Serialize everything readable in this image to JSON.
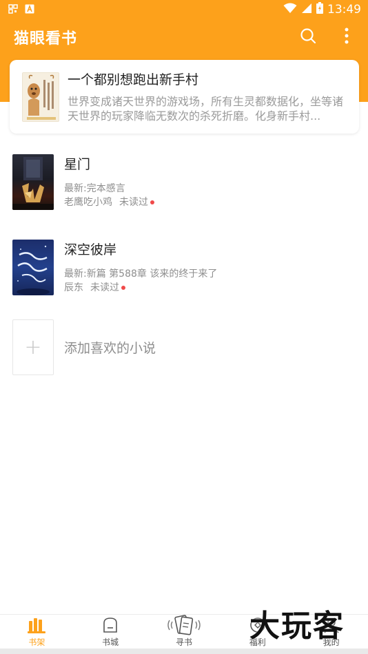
{
  "status_bar": {
    "time": "13:49",
    "left_icons": [
      "qr-icon",
      "a-icon"
    ],
    "right_icons": [
      "wifi-icon",
      "signal-icon",
      "battery-icon"
    ]
  },
  "header": {
    "title": "猫眼看书",
    "actions": [
      "search-icon",
      "more-icon"
    ]
  },
  "featured": {
    "title": "一个都别想跑出新手村",
    "description": "世界变成诸天世界的游戏场，所有生灵都数据化，坐等诸天世界的玩家降临无数次的杀死折磨。化身新手村..."
  },
  "books": [
    {
      "title": "星门",
      "latest": "最新:完本感言",
      "author": "老鹰吃小鸡",
      "status": "未读过"
    },
    {
      "title": "深空彼岸",
      "latest": "最新:新篇 第588章 该来的终于来了",
      "author": "辰东",
      "status": "未读过"
    }
  ],
  "add_book": {
    "symbol": "+",
    "label": "添加喜欢的小说"
  },
  "bottom_nav": [
    {
      "label": "书架",
      "icon": "bookshelf-icon",
      "active": true
    },
    {
      "label": "书城",
      "icon": "store-icon",
      "active": false
    },
    {
      "label": "寻书",
      "icon": "find-book-icon",
      "active": false
    },
    {
      "label": "福利",
      "icon": "welfare-icon",
      "active": false
    },
    {
      "label": "我的",
      "icon": "profile-icon",
      "active": false
    }
  ],
  "watermark": "大玩客",
  "colors": {
    "brand": "#FDA11B",
    "unread_dot": "#F04A4A",
    "text_primary": "#222222",
    "text_secondary": "#8E8E8E"
  }
}
